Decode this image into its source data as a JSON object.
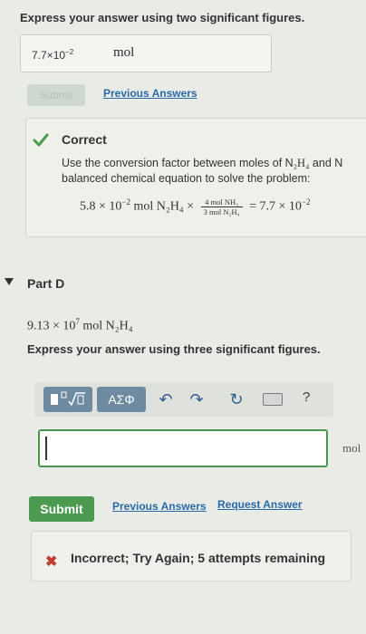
{
  "prev_answer": {
    "instruction": "Express your answer using two significant figures.",
    "value_mantissa": "7.7×10",
    "value_exponent": "−2",
    "unit": "mol",
    "submit_label": "Submit",
    "previous_answers_label": "Previous Answers"
  },
  "feedback": {
    "title": "Correct",
    "explanation_part1": "Use the conversion factor between moles of N",
    "explanation_part2": "and N",
    "explanation_line2": "balanced chemical equation to solve the problem:",
    "eq_lhs": "5.8 × 10",
    "eq_lhs_exp": "−2",
    "eq_lhs_unit": "mol N₂H₄ ×",
    "eq_frac_num": "4 mol NH₃",
    "eq_frac_den": "3 mol N₂H₄",
    "eq_rhs": "= 7.7 × 10",
    "eq_rhs_exp": "−2"
  },
  "part_d": {
    "title": "Part D",
    "given_mantissa": "9.13 × 10",
    "given_exp": "7",
    "given_unit": "mol N₂H₄",
    "instruction": "Express your answer using three significant figures.",
    "greek_label": "ΑΣΦ",
    "help_label": "?",
    "unit": "mol",
    "submit_label": "Submit",
    "previous_answers_label": "Previous Answers",
    "request_answer_label": "Request Answer",
    "incorrect_msg": "Incorrect; Try Again; 5 attempts remaining"
  },
  "colors": {
    "accent_green": "#4b9a4f",
    "link_blue": "#2a6aa8",
    "error_red": "#c43b2f"
  }
}
